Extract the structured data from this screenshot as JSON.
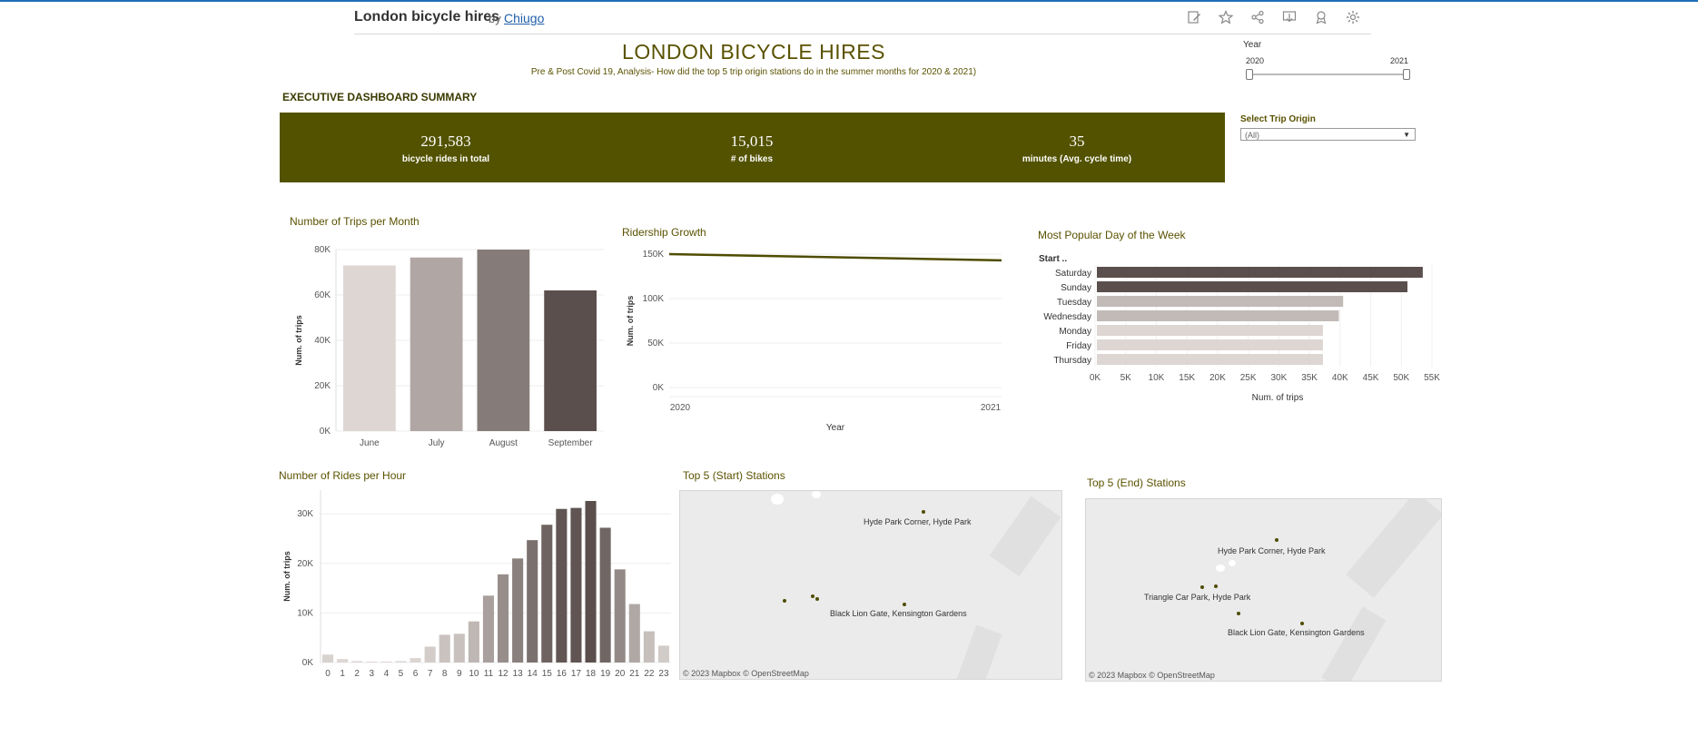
{
  "header": {
    "title": "London bicycle hires",
    "by": "by",
    "author": "Chiugo",
    "icons": [
      "edit-icon",
      "star-icon",
      "share-icon",
      "download-icon",
      "badge-icon",
      "gear-icon"
    ]
  },
  "dashboard": {
    "title": "LONDON BICYCLE HIRES",
    "subtitle": "Pre & Post Covid 19, Analysis- How did the top 5 trip origin stations do in the summer months for 2020 & 2021)",
    "section": "EXECUTIVE DASHBOARD SUMMARY",
    "kpis": [
      {
        "value": "291,583",
        "label": "bicycle rides in total"
      },
      {
        "value": "15,015",
        "label": "# of bikes"
      },
      {
        "value": "35",
        "label": "minutes (Avg. cycle time)"
      }
    ]
  },
  "filters": {
    "year_label": "Year",
    "year_min": "2020",
    "year_max": "2021",
    "origin_label": "Select Trip Origin",
    "origin_value": "(All)"
  },
  "colors": {
    "olive": "#535200",
    "title_olive": "#5a5200",
    "bar_dark": "#5a4f4c"
  },
  "chart_data": [
    {
      "type": "bar",
      "title": "Number of Trips per Month",
      "ylabel": "Num. of trips",
      "categories": [
        "June",
        "July",
        "August",
        "September"
      ],
      "values": [
        73000,
        76500,
        80000,
        62000
      ],
      "yticks": [
        "0K",
        "20K",
        "40K",
        "60K",
        "80K"
      ],
      "ylim": [
        0,
        80000
      ],
      "colors": [
        "#ddd6d3",
        "#b0a6a3",
        "#857c79",
        "#5a4f4c"
      ]
    },
    {
      "type": "line",
      "title": "Ridership Growth",
      "ylabel": "Num. of trips",
      "xlabel": "Year",
      "x": [
        "2020",
        "2021"
      ],
      "values": [
        150000,
        143000
      ],
      "yticks": [
        "0K",
        "50K",
        "100K",
        "150K"
      ],
      "ylim": [
        0,
        150000
      ],
      "color": "#4f4c00"
    },
    {
      "type": "bar",
      "orientation": "horizontal",
      "title": "Most Popular Day of the Week",
      "ylabel": "Start ..",
      "xlabel": "Num. of trips",
      "categories": [
        "Saturday",
        "Sunday",
        "Tuesday",
        "Wednesday",
        "Monday",
        "Friday",
        "Thursday"
      ],
      "values": [
        53500,
        51000,
        40500,
        39800,
        37200,
        37200,
        37200
      ],
      "xticks": [
        "0K",
        "5K",
        "10K",
        "15K",
        "20K",
        "25K",
        "30K",
        "35K",
        "40K",
        "45K",
        "50K",
        "55K"
      ],
      "xlim": [
        0,
        55000
      ],
      "colors": [
        "#5a4f4c",
        "#5a4f4c",
        "#c1bab7",
        "#c1bab7",
        "#ddd6d3",
        "#ddd6d3",
        "#ddd6d3"
      ]
    },
    {
      "type": "bar",
      "title": "Number of Rides per Hour",
      "ylabel": "Num. of trips",
      "categories": [
        "0",
        "1",
        "2",
        "3",
        "4",
        "5",
        "6",
        "7",
        "8",
        "9",
        "10",
        "11",
        "12",
        "13",
        "14",
        "15",
        "16",
        "17",
        "18",
        "19",
        "20",
        "21",
        "22",
        "23"
      ],
      "values": [
        1600,
        700,
        300,
        200,
        200,
        300,
        900,
        3200,
        5600,
        5800,
        8300,
        13500,
        17800,
        21000,
        24700,
        27800,
        31000,
        31200,
        32600,
        27200,
        18800,
        11800,
        6300,
        3400
      ],
      "yticks": [
        "0K",
        "10K",
        "20K",
        "30K"
      ],
      "ylim": [
        0,
        32600
      ]
    }
  ],
  "maps": [
    {
      "title": "Top 5 (Start) Stations",
      "labels": [
        "Hyde Park Corner, Hyde Park",
        "Black Lion Gate, Kensington Gardens"
      ],
      "attribution": "© 2023 Mapbox  © OpenStreetMap"
    },
    {
      "title": "Top 5 (End) Stations",
      "labels": [
        "Hyde Park Corner, Hyde Park",
        "Triangle Car Park, Hyde Park",
        "Black Lion Gate, Kensington Gardens"
      ],
      "attribution": "© 2023 Mapbox  © OpenStreetMap"
    }
  ]
}
